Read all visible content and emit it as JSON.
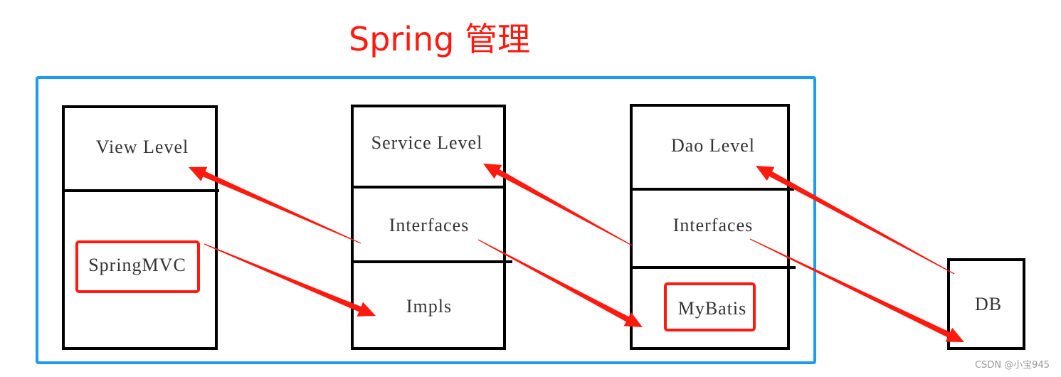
{
  "title": "Spring 管理",
  "columns": {
    "view": {
      "header": "View Level",
      "component": "SpringMVC"
    },
    "service": {
      "header": "Service Level",
      "interfaces": "Interfaces",
      "impls": "Impls"
    },
    "dao": {
      "header": "Dao Level",
      "interfaces": "Interfaces",
      "component": "MyBatis"
    },
    "db": {
      "label": "DB"
    }
  },
  "arrows": [
    {
      "from": "SpringMVC",
      "to": "Service Impls"
    },
    {
      "from": "Service Interfaces",
      "to": "View Level"
    },
    {
      "from": "Service Interfaces",
      "to": "Dao MyBatis"
    },
    {
      "from": "Dao Interfaces",
      "to": "Service Level"
    },
    {
      "from": "Dao Interfaces",
      "to": "DB"
    },
    {
      "from": "DB",
      "to": "Dao Level"
    }
  ],
  "colors": {
    "frame": "#1e9bf0",
    "accent": "#ff1a10",
    "box": "#000000"
  },
  "watermark": "CSDN @小宝945"
}
